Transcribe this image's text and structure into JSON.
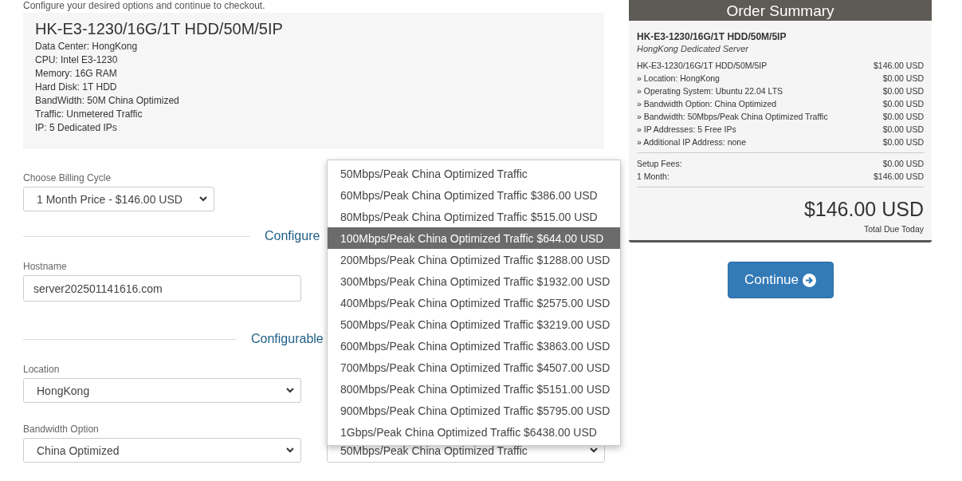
{
  "intro": "Configure your desired options and continue to checkout.",
  "product": {
    "title": "HK-E3-1230/16G/1T HDD/50M/5IP",
    "details": [
      "Data Center: HongKong",
      "CPU: Intel E3-1230",
      "Memory: 16G RAM",
      "Hard Disk: 1T HDD",
      "BandWidth: 50M China Optimized",
      "Traffic: Unmetered Traffic",
      "IP: 5 Dedicated IPs"
    ]
  },
  "billing_cycle": {
    "label": "Choose Billing Cycle",
    "value": "1 Month Price - $146.00 USD"
  },
  "sections": [
    {
      "heading": "Configure",
      "rows": [
        [
          {
            "kind": "input",
            "label": "Hostname",
            "value": "server202501141616.com"
          }
        ]
      ]
    },
    {
      "heading": "Configurable",
      "rows": [
        [
          {
            "kind": "select",
            "label": "Location",
            "value": "HongKong"
          }
        ],
        [
          {
            "kind": "select",
            "label": "Bandwidth Option",
            "value": "China Optimized"
          },
          {
            "kind": "select",
            "value": "50Mbps/Peak China Optimized Traffic"
          }
        ]
      ]
    }
  ],
  "dropdown": {
    "options": [
      {
        "label": "50Mbps/Peak China Optimized Traffic",
        "selected": false
      },
      {
        "label": "60Mbps/Peak China Optimized Traffic $386.00 USD",
        "selected": false
      },
      {
        "label": "80Mbps/Peak China Optimized Traffic $515.00 USD",
        "selected": false
      },
      {
        "label": "100Mbps/Peak China Optimized Traffic $644.00 USD",
        "selected": true
      },
      {
        "label": "200Mbps/Peak China Optimized Traffic $1288.00 USD",
        "selected": false
      },
      {
        "label": "300Mbps/Peak China Optimized Traffic $1932.00 USD",
        "selected": false
      },
      {
        "label": "400Mbps/Peak China Optimized Traffic $2575.00 USD",
        "selected": false
      },
      {
        "label": "500Mbps/Peak China Optimized Traffic $3219.00 USD",
        "selected": false
      },
      {
        "label": "600Mbps/Peak China Optimized Traffic $3863.00 USD",
        "selected": false
      },
      {
        "label": "700Mbps/Peak China Optimized Traffic $4507.00 USD",
        "selected": false
      },
      {
        "label": "800Mbps/Peak China Optimized Traffic $5151.00 USD",
        "selected": false
      },
      {
        "label": "900Mbps/Peak China Optimized Traffic $5795.00 USD",
        "selected": false
      },
      {
        "label": "1Gbps/Peak China Optimized Traffic $6438.00 USD",
        "selected": false
      }
    ]
  },
  "order_summary": {
    "title": "Order Summary",
    "product": "HK-E3-1230/16G/1T HDD/50M/5IP",
    "group": "HongKong Dedicated Server",
    "lines": [
      {
        "label": "HK-E3-1230/16G/1T HDD/50M/5IP",
        "price": "$146.00 USD"
      },
      {
        "label": "» Location: HongKong",
        "price": "$0.00 USD"
      },
      {
        "label": "» Operating System: Ubuntu 22.04 LTS",
        "price": "$0.00 USD"
      },
      {
        "label": "» Bandwidth Option: China Optimized",
        "price": "$0.00 USD"
      },
      {
        "label": "» Bandwidth: 50Mbps/Peak China Optimized Traffic",
        "price": "$0.00 USD"
      },
      {
        "label": "» IP Addresses: 5 Free IPs",
        "price": "$0.00 USD"
      },
      {
        "label": "» Additional IP Address: none",
        "price": "$0.00 USD"
      }
    ],
    "fees": [
      {
        "label": "Setup Fees:",
        "price": "$0.00 USD"
      },
      {
        "label": "1 Month:",
        "price": "$146.00 USD"
      }
    ],
    "total": "$146.00 USD",
    "total_label": "Total Due Today"
  },
  "continue_button": "Continue"
}
